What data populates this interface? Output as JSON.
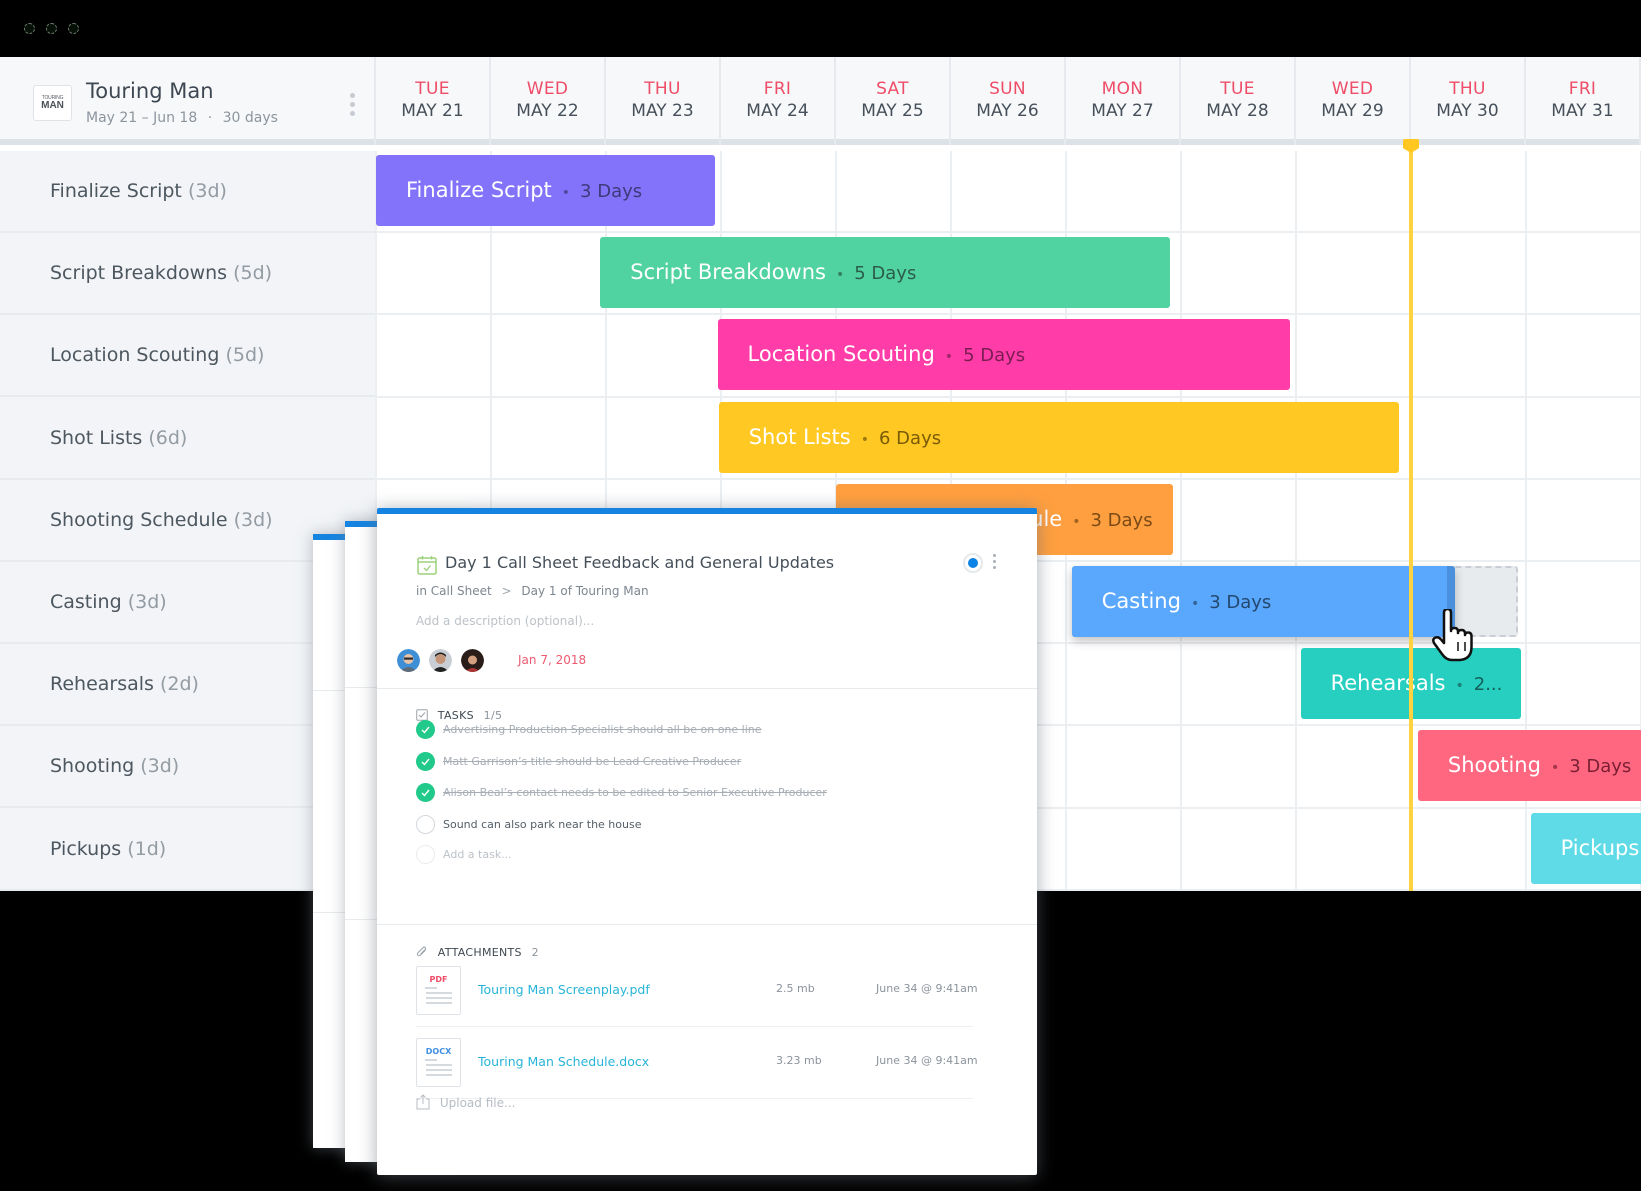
{
  "window": {
    "controls": [
      "close",
      "minimize",
      "maximize"
    ]
  },
  "project": {
    "logo_line1": "TOURING",
    "logo_line2": "MAN",
    "title": "Touring Man",
    "date_range": "May 21 – Jun 18",
    "separator": "·",
    "duration": "30 days"
  },
  "timeline": {
    "days": [
      {
        "dow": "TUE",
        "date": "MAY 21"
      },
      {
        "dow": "WED",
        "date": "MAY 22"
      },
      {
        "dow": "THU",
        "date": "MAY 23"
      },
      {
        "dow": "FRI",
        "date": "MAY 24"
      },
      {
        "dow": "SAT",
        "date": "MAY 25"
      },
      {
        "dow": "SUN",
        "date": "MAY 26"
      },
      {
        "dow": "MON",
        "date": "MAY 27"
      },
      {
        "dow": "TUE",
        "date": "MAY 28"
      },
      {
        "dow": "WED",
        "date": "MAY 29"
      },
      {
        "dow": "THU",
        "date": "MAY 30"
      },
      {
        "dow": "FRI",
        "date": "MAY 31"
      }
    ],
    "today_index": 9,
    "today_color": "#ffd23f"
  },
  "tasks": [
    {
      "name": "Finalize Script",
      "dur_label": "(3d)",
      "bar_label": "Finalize Script",
      "bar_days": "3 Days",
      "start_day": 0,
      "length_days": 2.95,
      "color": "#8372fa",
      "days_color": "#3e3a7a"
    },
    {
      "name": "Script Breakdowns",
      "dur_label": "(5d)",
      "bar_label": "Script Breakdowns",
      "bar_days": "5 Days",
      "start_day": 1.95,
      "length_days": 4.95,
      "color": "#50d2a1",
      "days_color": "#2b5d4c"
    },
    {
      "name": "Location Scouting",
      "dur_label": "(5d)",
      "bar_label": "Location Scouting",
      "bar_days": "5 Days",
      "start_day": 2.97,
      "length_days": 4.98,
      "color": "#ff3ca8",
      "days_color": "#7a1d53"
    },
    {
      "name": "Shot Lists",
      "dur_label": "(6d)",
      "bar_label": "Shot Lists",
      "bar_days": "6 Days",
      "start_day": 2.98,
      "length_days": 5.92,
      "color": "#ffc822",
      "days_color": "#7a5b08"
    },
    {
      "name": "Shooting Schedule",
      "dur_label": "(3d)",
      "bar_label": "Shooting Schedule",
      "bar_days": "3 Days",
      "start_day": 4.0,
      "length_days": 2.93,
      "color": "#ff9f3f",
      "days_color": "#7a4a17"
    },
    {
      "name": "Casting",
      "dur_label": "(3d)",
      "bar_label": "Casting",
      "bar_days": "3 Days",
      "start_day": 6.05,
      "length_days": 3.33,
      "color": "#59a8fd",
      "days_color": "#24476e",
      "dragging": true,
      "ghost_end_day": 9.93
    },
    {
      "name": "Rehearsals",
      "dur_label": "(2d)",
      "bar_label": "Rehearsals",
      "bar_days": "2...",
      "start_day": 8.04,
      "length_days": 1.92,
      "color": "#27cfc0",
      "days_color": "#145f58"
    },
    {
      "name": "Shooting",
      "dur_label": "(3d)",
      "bar_label": "Shooting",
      "bar_days": "3 Days",
      "start_day": 9.06,
      "length_days": 3,
      "color": "#ff6680",
      "days_color": "#7a1f33"
    },
    {
      "name": "Pickups",
      "dur_label": "(1d)",
      "bar_label": "Pickups...",
      "bar_days": "",
      "start_day": 10.04,
      "length_days": 1,
      "color": "#5edbe7",
      "days_color": "#1f6870"
    }
  ],
  "card": {
    "title": "Day 1 Call Sheet Feedback and General Updates",
    "crumb_prefix": "in",
    "crumb_parent": "Call Sheet",
    "crumb_sep": ">",
    "crumb_child": "Day 1 of Touring Man",
    "description_placeholder": "Add a description (optional)...",
    "due_date": "Jan 7, 2018",
    "status_color": "#0b82e5",
    "assignees": [
      "assignee-1",
      "assignee-2",
      "assignee-3"
    ],
    "tasks_heading": "TASKS",
    "tasks_count": "1/5",
    "checklist": [
      {
        "text": "Advertising Production Specialist should all be on one line",
        "done": true
      },
      {
        "text": "Matt Garrison’s title should be Lead Creative Producer",
        "done": true
      },
      {
        "text": "Alison Beal’s contact needs to be edited to Senior Executive Producer",
        "done": true
      },
      {
        "text": "Sound can also park near the house",
        "done": false
      }
    ],
    "add_task_placeholder": "Add a task...",
    "attachments_heading": "ATTACHMENTS",
    "attachments_count": "2",
    "attachments": [
      {
        "type": "PDF",
        "type_color": "#ee4d68",
        "name": "Touring Man Screenplay.pdf",
        "size": "2.5 mb",
        "date": "June 34 @ 9:41am"
      },
      {
        "type": "DOCX",
        "type_color": "#3d8fe0",
        "name": "Touring Man Schedule.docx",
        "size": "3.23 mb",
        "date": "June 34 @ 9:41am"
      }
    ],
    "upload_label": "Upload file..."
  }
}
